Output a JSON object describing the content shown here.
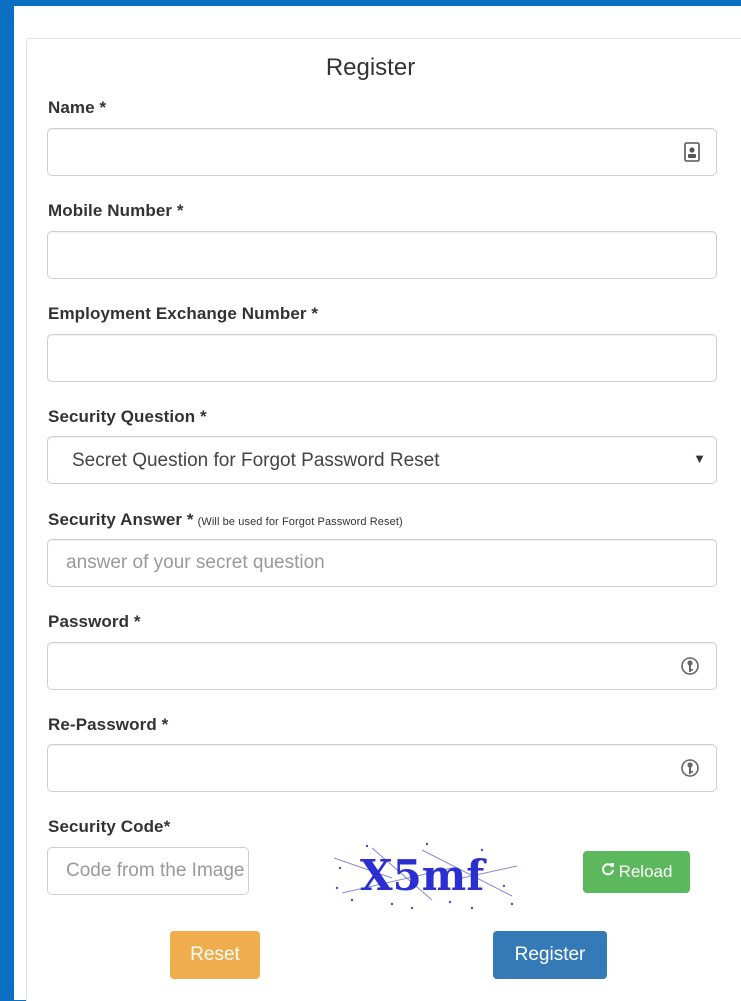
{
  "form": {
    "title": "Register",
    "name_label": "Name *",
    "mobile_label": "Mobile Number *",
    "exchange_label": "Employment Exchange Number *",
    "question_label": "Security Question *",
    "question_selected": "Secret Question for Forgot Password Reset",
    "answer_label": "Security Answer *",
    "answer_hint": "(Will be used for Forgot Password Reset)",
    "answer_placeholder": "answer of your secret question",
    "password_label": "Password *",
    "repassword_label": "Re-Password *",
    "code_label": "Security Code*",
    "code_placeholder": "Code from the Image",
    "captcha_text": "X5mf",
    "reload_label": "Reload",
    "reset_label": "Reset",
    "register_label": "Register"
  },
  "colors": {
    "background": "#0b6fc2",
    "reset": "#f0ad4e",
    "register": "#337ab7",
    "reload": "#5cb85c",
    "captcha": "#2b2ed0"
  },
  "icons": {
    "name_field": "contact-card-icon",
    "password_field": "key-icon",
    "reload": "refresh-icon",
    "select": "caret-down-icon"
  }
}
